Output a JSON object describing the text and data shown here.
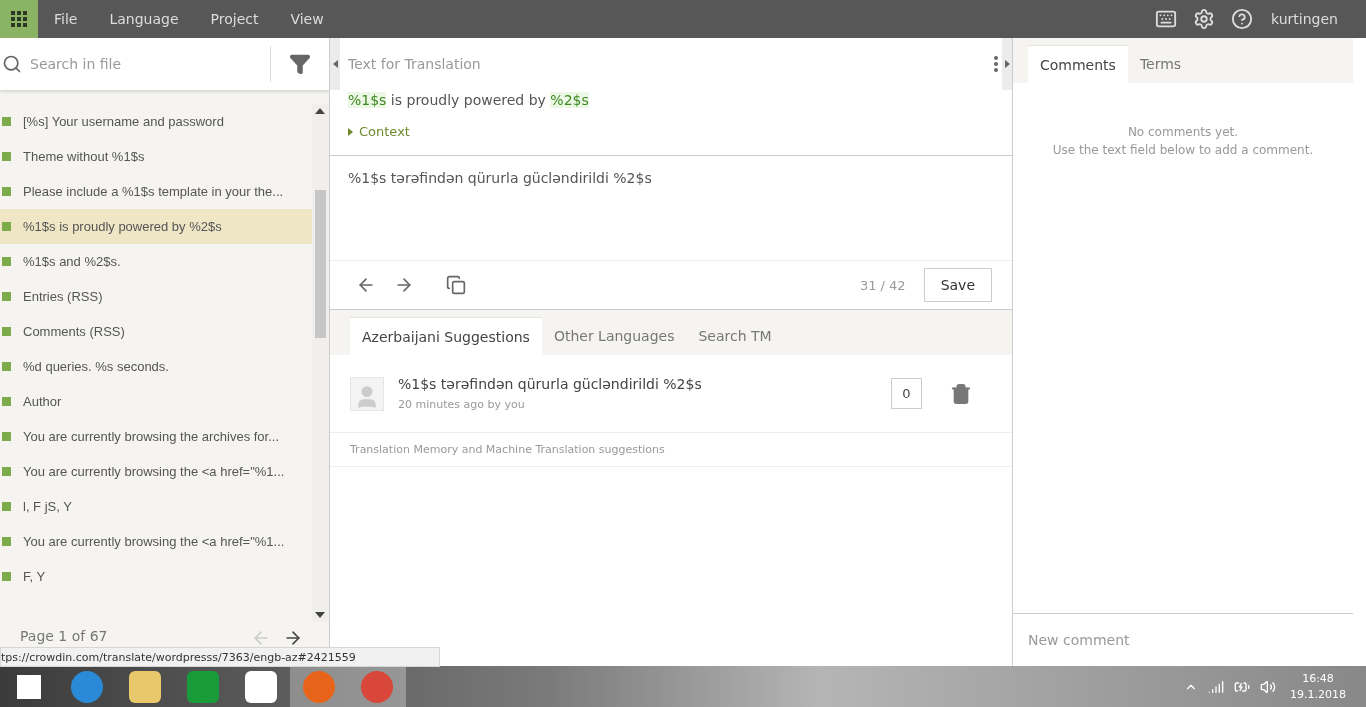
{
  "menu": {
    "items": [
      "File",
      "Language",
      "Project",
      "View"
    ],
    "user": "kurtingen"
  },
  "sidebar": {
    "search": {
      "placeholder": "Search in file"
    },
    "strings": [
      {
        "text": "[%s] Your username and password",
        "selected": false,
        "color": "#7cab4c"
      },
      {
        "text": "Theme without %1$s",
        "selected": false,
        "color": "#7cab4c"
      },
      {
        "text": "Please include a %1$s template in your the...",
        "selected": false,
        "color": "#7cab4c"
      },
      {
        "text": "%1$s is proudly powered by %2$s",
        "selected": true,
        "color": "#7cab4c"
      },
      {
        "text": "%1$s and %2$s.",
        "selected": false,
        "color": "#7cab4c"
      },
      {
        "text": "Entries (RSS)",
        "selected": false,
        "color": "#7cab4c"
      },
      {
        "text": "Comments (RSS)",
        "selected": false,
        "color": "#7cab4c"
      },
      {
        "text": "%d queries. %s seconds.",
        "selected": false,
        "color": "#7cab4c"
      },
      {
        "text": "Author",
        "selected": false,
        "color": "#7cab4c"
      },
      {
        "text": "You are currently browsing the archives for...",
        "selected": false,
        "color": "#7cab4c"
      },
      {
        "text": "You are currently browsing the <a href=\"%1...",
        "selected": false,
        "color": "#7cab4c"
      },
      {
        "text": "l, F jS, Y",
        "selected": false,
        "color": "#7cab4c"
      },
      {
        "text": "You are currently browsing the <a href=\"%1...",
        "selected": false,
        "color": "#7cab4c"
      },
      {
        "text": "F, Y",
        "selected": false,
        "color": "#7cab4c"
      }
    ],
    "pager": "Page 1 of 67"
  },
  "editor": {
    "title": "Text for Translation",
    "source": [
      {
        "text": "%1$s",
        "kind": "placeholder"
      },
      {
        "text": " is proudly powered by ",
        "kind": "plain"
      },
      {
        "text": "%2$s",
        "kind": "placeholder"
      }
    ],
    "context": "Context",
    "translation": "%1$s tərəfindən qürurla gücləndirildi %2$s",
    "counter": "31 / 42",
    "save": "Save"
  },
  "suggestions": {
    "tabs": [
      {
        "label": "Azerbaijani Suggestions",
        "selected": true
      },
      {
        "label": "Other Languages",
        "selected": false
      },
      {
        "label": "Search TM",
        "selected": false
      }
    ],
    "items": [
      {
        "text": "%1$s tərəfindən qürurla gücləndirildi %2$s",
        "meta": "20 minutes ago by you",
        "votes": "0"
      }
    ],
    "tm_label": "Translation Memory and Machine Translation suggestions"
  },
  "comments": {
    "tabs": [
      {
        "label": "Comments",
        "selected": true
      },
      {
        "label": "Terms",
        "selected": false
      }
    ],
    "empty": [
      "No comments yet.",
      "Use the text field below to add a comment."
    ],
    "placeholder": "New comment"
  },
  "status_url": "tps://crowdin.com/translate/wordpresss/7363/engb-az#2421559",
  "taskbar": {
    "time": "16:48",
    "date": "19.1.2018"
  }
}
